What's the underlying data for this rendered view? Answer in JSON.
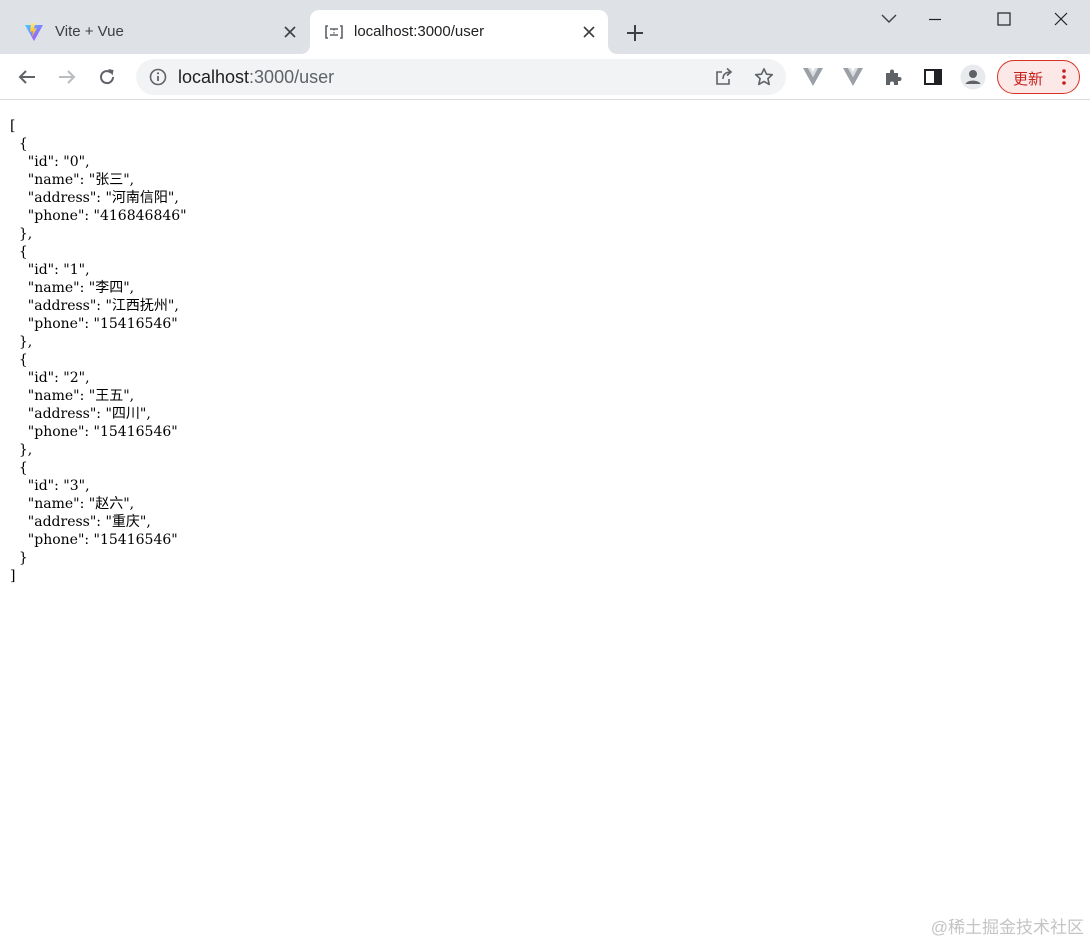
{
  "tabs": [
    {
      "title": "Vite + Vue",
      "active": false,
      "favicon": "vite-logo-icon"
    },
    {
      "title": "localhost:3000/user",
      "active": true,
      "favicon": "page-icon"
    }
  ],
  "omnibox": {
    "host": "localhost",
    "path": ":3000/user"
  },
  "update_button": {
    "label": "更新"
  },
  "colors": {
    "tabbar_bg": "#dee1e6",
    "omnibox_bg": "#f1f3f4",
    "update_accent": "#d93025"
  },
  "json_lines": [
    "[",
    "  {",
    "    \"id\": \"0\",",
    "    \"name\": \"张三\",",
    "    \"address\": \"河南信阳\",",
    "    \"phone\": \"416846846\"",
    "  },",
    "  {",
    "    \"id\": \"1\",",
    "    \"name\": \"李四\",",
    "    \"address\": \"江西抚州\",",
    "    \"phone\": \"15416546\"",
    "  },",
    "  {",
    "    \"id\": \"2\",",
    "    \"name\": \"王五\",",
    "    \"address\": \"四川\",",
    "    \"phone\": \"15416546\"",
    "  },",
    "  {",
    "    \"id\": \"3\",",
    "    \"name\": \"赵六\",",
    "    \"address\": \"重庆\",",
    "    \"phone\": \"15416546\"",
    "  }",
    "]"
  ],
  "watermark": "@稀土掘金技术社区"
}
